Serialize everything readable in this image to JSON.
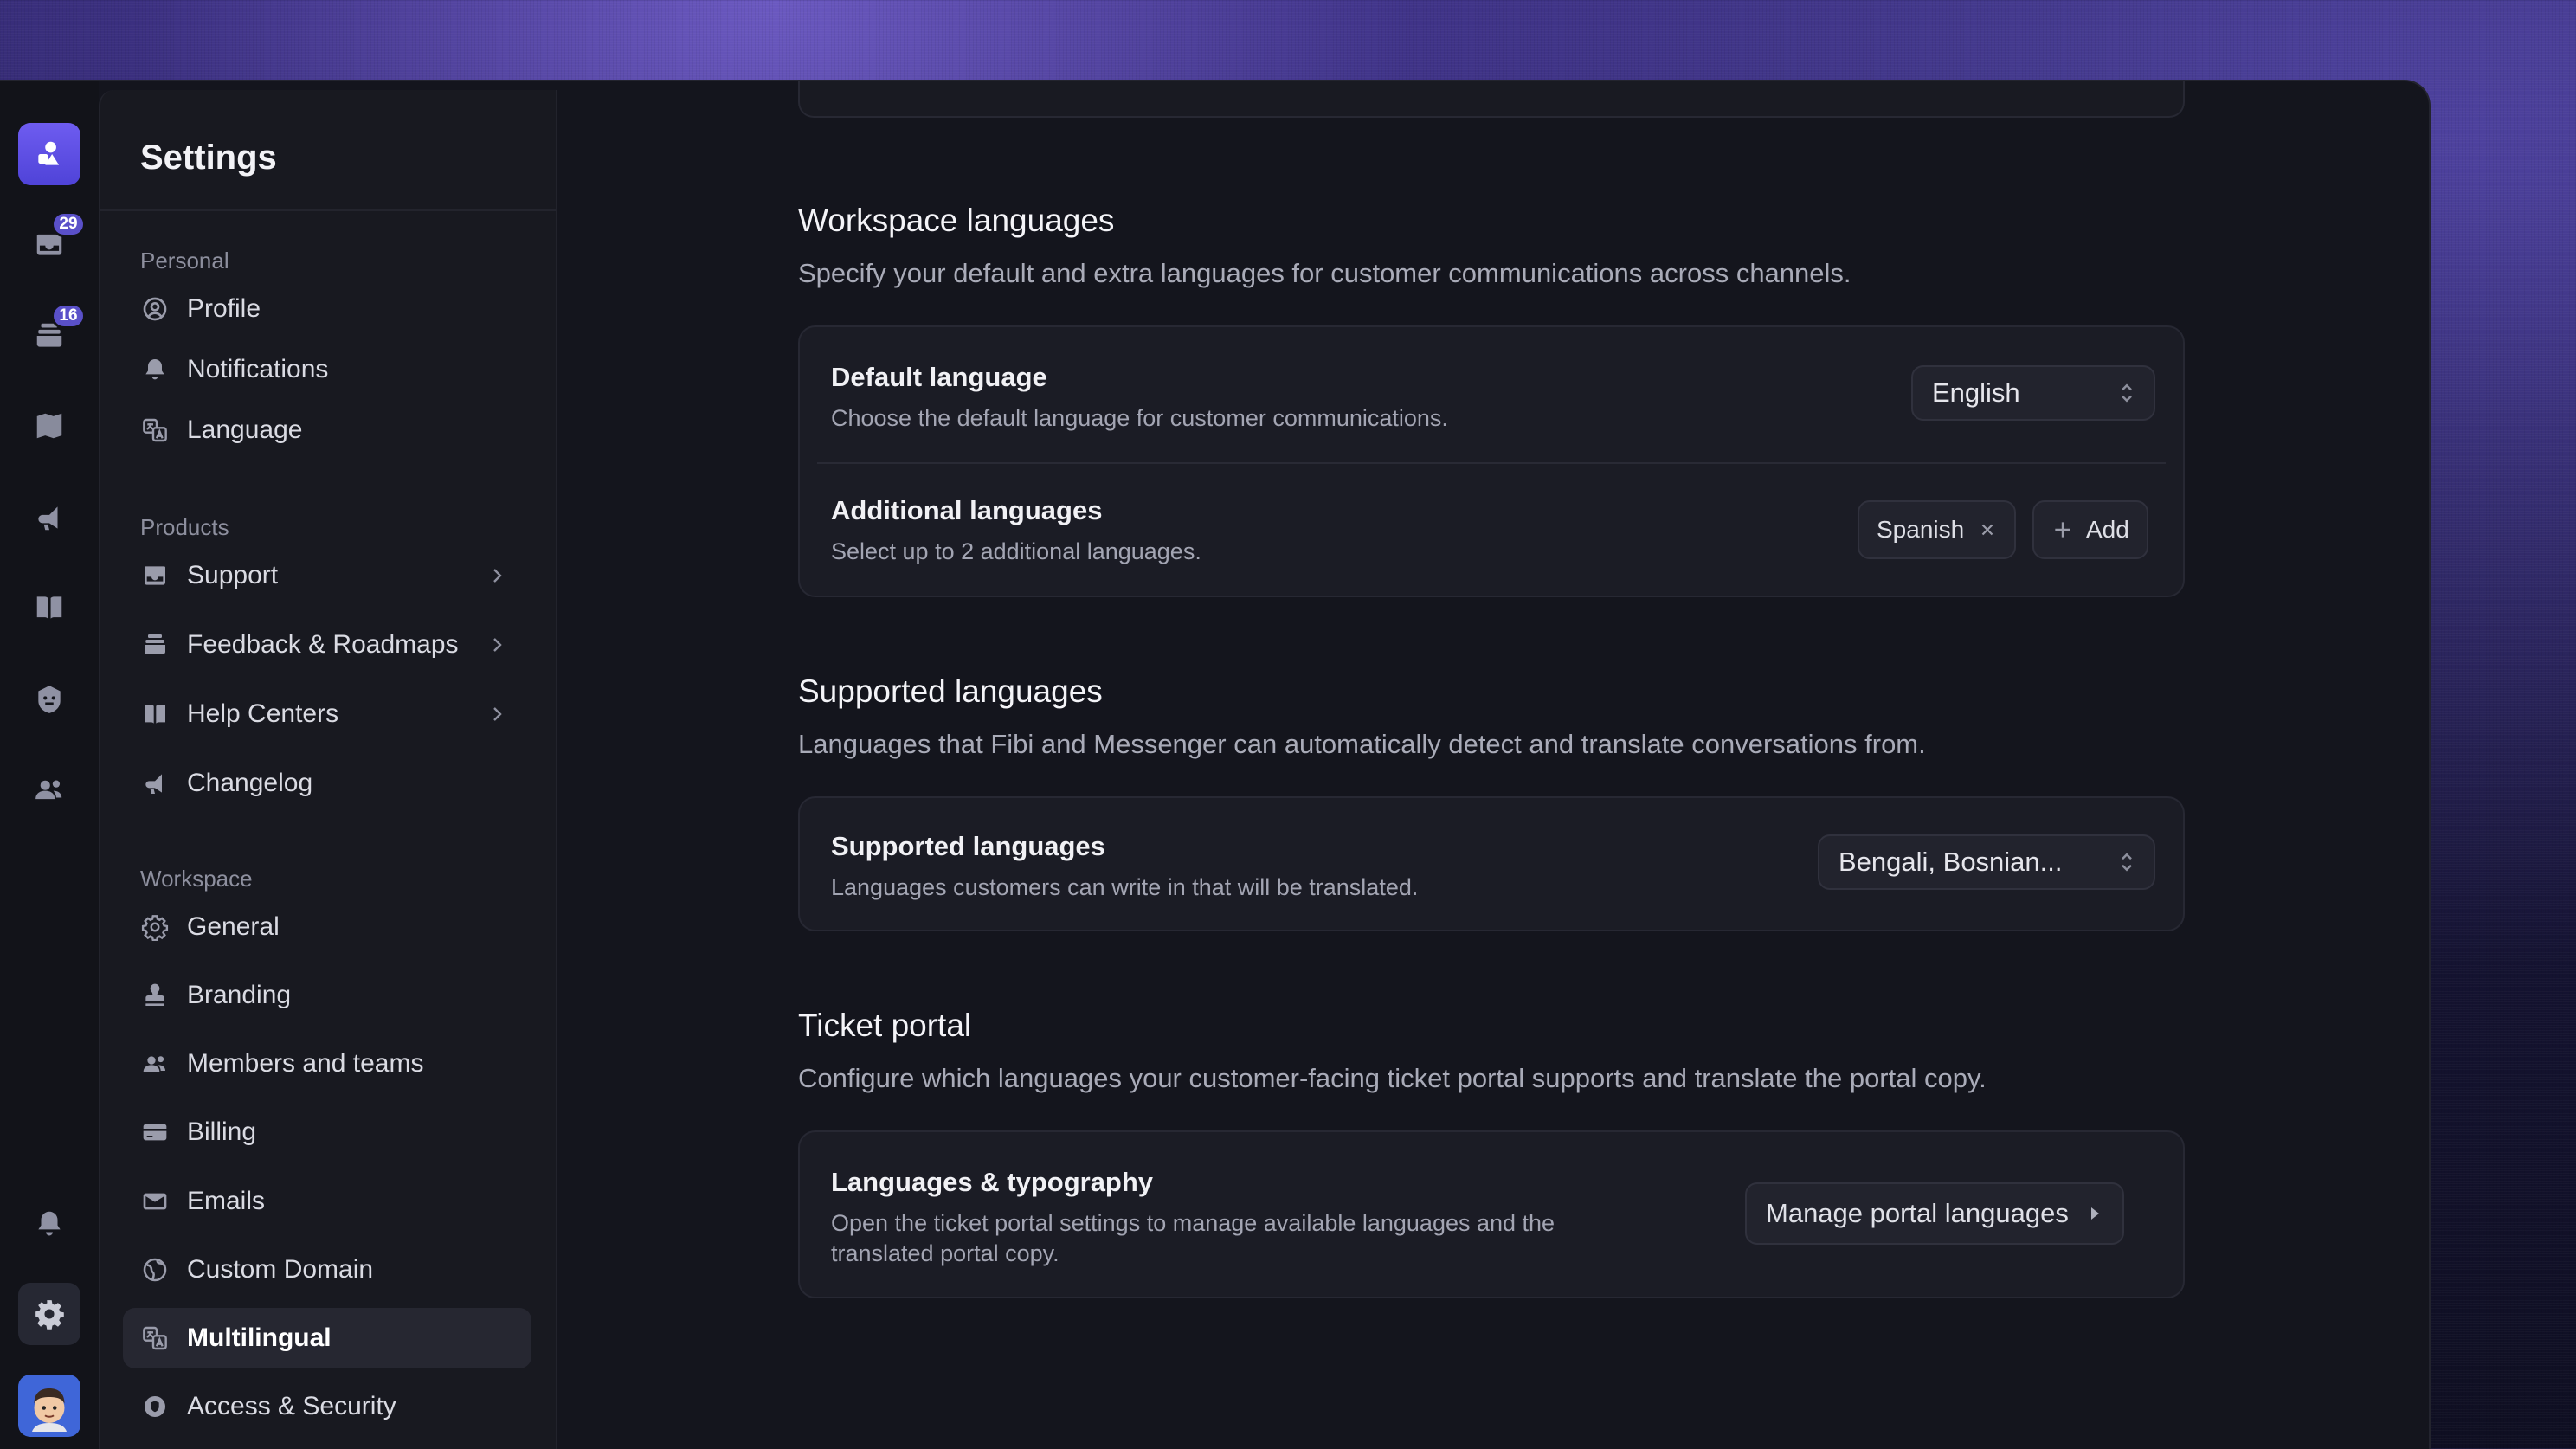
{
  "rail": {
    "badges": {
      "inbox": "29",
      "tickets": "16"
    }
  },
  "sidebar": {
    "title": "Settings",
    "personal_label": "Personal",
    "personal_items": [
      {
        "label": "Profile",
        "icon": "user-circle-icon"
      },
      {
        "label": "Notifications",
        "icon": "bell-icon"
      },
      {
        "label": "Language",
        "icon": "translate-icon"
      }
    ],
    "products_label": "Products",
    "products_items": [
      {
        "label": "Support",
        "icon": "inbox-icon"
      },
      {
        "label": "Feedback & Roadmaps",
        "icon": "stack-icon"
      },
      {
        "label": "Help Centers",
        "icon": "book-icon"
      },
      {
        "label": "Changelog",
        "icon": "megaphone-icon"
      }
    ],
    "workspace_label": "Workspace",
    "workspace_items": [
      {
        "label": "General",
        "icon": "gear-icon"
      },
      {
        "label": "Branding",
        "icon": "stamp-icon"
      },
      {
        "label": "Members and teams",
        "icon": "users-icon"
      },
      {
        "label": "Billing",
        "icon": "credit-card-icon"
      },
      {
        "label": "Emails",
        "icon": "mail-icon"
      },
      {
        "label": "Custom Domain",
        "icon": "globe-icon"
      },
      {
        "label": "Multilingual",
        "icon": "translate-icon"
      },
      {
        "label": "Access & Security",
        "icon": "shield-icon"
      }
    ]
  },
  "workspace_languages": {
    "title": "Workspace languages",
    "description": "Specify your default and extra languages for customer communications across channels.",
    "default_language": {
      "title": "Default language",
      "description": "Choose the default language for customer communications.",
      "value": "English"
    },
    "additional_languages": {
      "title": "Additional languages",
      "description": "Select up to 2 additional languages.",
      "chips": [
        "Spanish"
      ],
      "add_label": "Add"
    }
  },
  "supported_languages": {
    "title": "Supported languages",
    "description": "Languages that Fibi and Messenger can automatically detect and translate conversations from.",
    "row": {
      "title": "Supported languages",
      "description": "Languages customers can write in that will be translated.",
      "value": "Bengali, Bosnian..."
    }
  },
  "ticket_portal": {
    "title": "Ticket portal",
    "description": "Configure which languages your customer-facing ticket portal supports and translate the portal copy.",
    "row": {
      "title": "Languages & typography",
      "description_line1": "Open the ticket portal settings to manage available languages and the",
      "description_line2": "translated portal copy.",
      "button_label": "Manage portal languages"
    }
  },
  "colors": {
    "accent": "#5a50c9",
    "background": "#14151d",
    "card": "#1b1c25"
  }
}
